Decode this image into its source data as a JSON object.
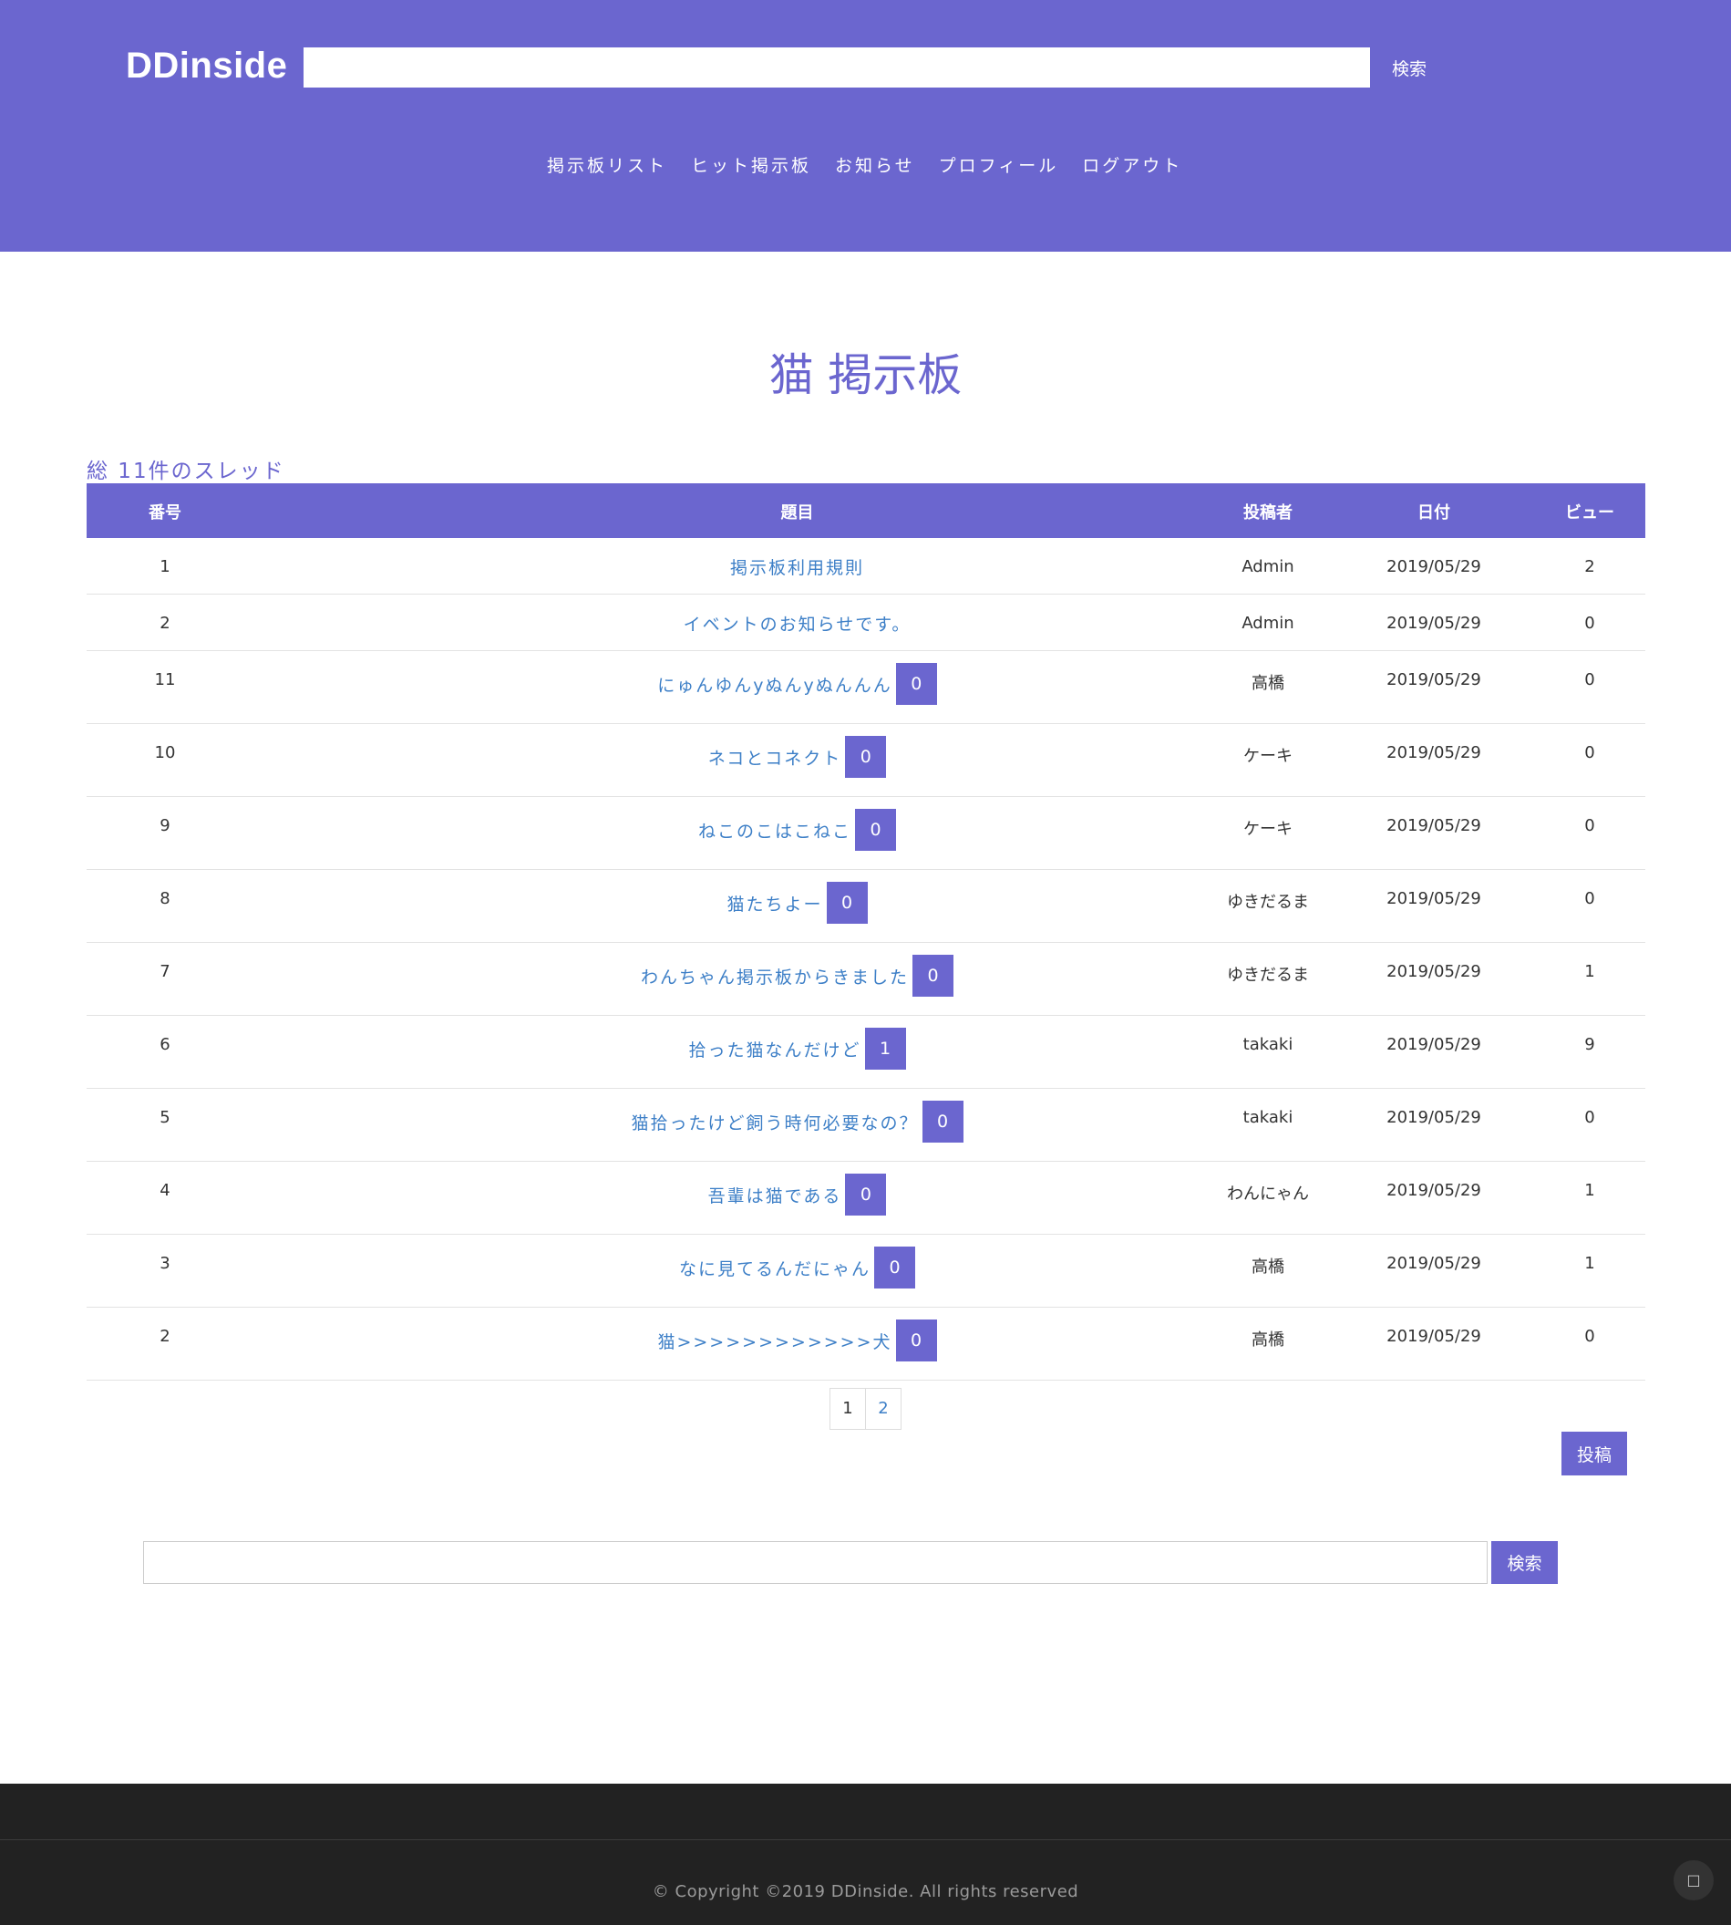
{
  "header": {
    "logo": "DDinside",
    "search_value": "",
    "search_button": "検索",
    "nav": [
      "掲示板リスト",
      "ヒット掲示板",
      "お知らせ",
      "プロフィール",
      "ログアウト"
    ]
  },
  "board": {
    "title": "猫 掲示板",
    "count_text": "総 11件のスレッド",
    "columns": [
      "番号",
      "題目",
      "投稿者",
      "日付",
      "ビュー"
    ],
    "rows": [
      {
        "no": "1",
        "title": "掲示板利用規則",
        "badge": "",
        "author": "Admin",
        "date": "2019/05/29",
        "views": "2"
      },
      {
        "no": "2",
        "title": "イベントのお知らせです。",
        "badge": "",
        "author": "Admin",
        "date": "2019/05/29",
        "views": "0"
      },
      {
        "no": "11",
        "title": "にゅんゆんyぬんyぬんんん",
        "badge": "0",
        "author": "高橋",
        "date": "2019/05/29",
        "views": "0"
      },
      {
        "no": "10",
        "title": "ネコとコネクト",
        "badge": "0",
        "author": "ケーキ",
        "date": "2019/05/29",
        "views": "0"
      },
      {
        "no": "9",
        "title": "ねこのこはこねこ",
        "badge": "0",
        "author": "ケーキ",
        "date": "2019/05/29",
        "views": "0"
      },
      {
        "no": "8",
        "title": "猫たちよー",
        "badge": "0",
        "author": "ゆきだるま",
        "date": "2019/05/29",
        "views": "0"
      },
      {
        "no": "7",
        "title": "わんちゃん掲示板からきました",
        "badge": "0",
        "author": "ゆきだるま",
        "date": "2019/05/29",
        "views": "1"
      },
      {
        "no": "6",
        "title": "拾った猫なんだけど",
        "badge": "1",
        "author": "takaki",
        "date": "2019/05/29",
        "views": "9"
      },
      {
        "no": "5",
        "title": "猫拾ったけど飼う時何必要なの？",
        "badge": "0",
        "author": "takaki",
        "date": "2019/05/29",
        "views": "0"
      },
      {
        "no": "4",
        "title": "吾輩は猫である",
        "badge": "0",
        "author": "わんにゃん",
        "date": "2019/05/29",
        "views": "1"
      },
      {
        "no": "3",
        "title": "なに見てるんだにゃん",
        "badge": "0",
        "author": "高橋",
        "date": "2019/05/29",
        "views": "1"
      },
      {
        "no": "2",
        "title": "猫>>>>>>>>>>>>犬",
        "badge": "0",
        "author": "高橋",
        "date": "2019/05/29",
        "views": "0"
      }
    ]
  },
  "pagination": {
    "pages": [
      "1",
      "2"
    ],
    "current": "1"
  },
  "post_button": "投稿",
  "bottom_search": {
    "value": "",
    "button": "検索"
  },
  "footer": {
    "copyright": "© Copyright ©2019 DDinside. All rights reserved",
    "scroll_top_icon": "□"
  },
  "colors": {
    "accent": "#6b66cf",
    "link": "#3d7fc7",
    "footer_bg": "#222222"
  }
}
